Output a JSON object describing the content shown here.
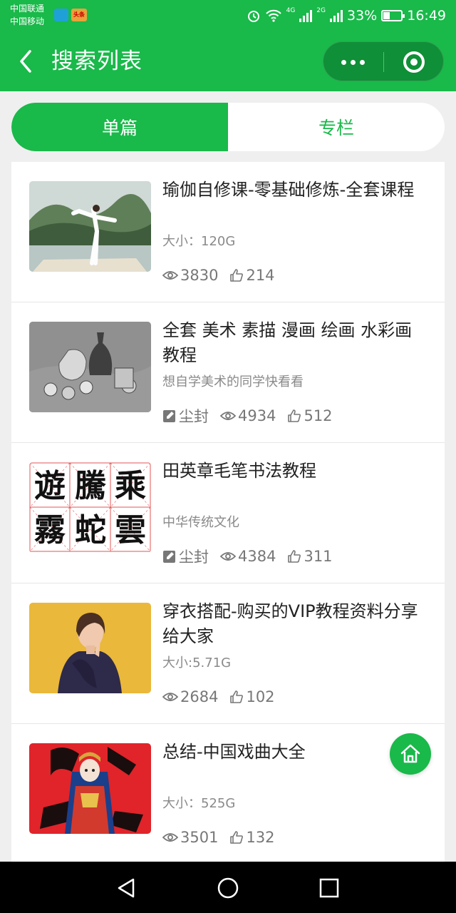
{
  "status_bar": {
    "carrier_1": "中国联通",
    "carrier_2": "中国移动",
    "mini_app_2": "头条",
    "network_1": "4G",
    "network_2": "2G",
    "battery": "33%",
    "time": "16:49"
  },
  "header": {
    "title": "搜索列表",
    "back_icon": "chevron-left-icon",
    "more_icon": "more-dots-icon",
    "close_icon": "target-circle-icon"
  },
  "tabs": [
    {
      "label": "单篇",
      "active": true
    },
    {
      "label": "专栏",
      "active": false
    }
  ],
  "list": [
    {
      "title": "瑜伽自修课-零基础修炼-全套课程",
      "subtitle": "大小：120G",
      "author": "",
      "views": "3830",
      "likes": "214",
      "thumb_desc": "yoga"
    },
    {
      "title": "全套 美术 素描 漫画 绘画 水彩画 教程",
      "subtitle": "想自学美术的同学快看看",
      "author": "尘封",
      "views": "4934",
      "likes": "512",
      "thumb_desc": "sketch"
    },
    {
      "title": "田英章毛笔书法教程",
      "subtitle": "中华传统文化",
      "author": "尘封",
      "views": "4384",
      "likes": "311",
      "thumb_desc": "calligraphy",
      "calligraphy_text": [
        "遊",
        "騰",
        "乘",
        "霧",
        "蛇",
        "雲"
      ]
    },
    {
      "title": "穿衣搭配-购买的VIP教程资料分享给大家",
      "subtitle": "大小:5.71G",
      "author": "",
      "views": "2684",
      "likes": "102",
      "thumb_desc": "fashion"
    },
    {
      "title": "总结-中国戏曲大全",
      "subtitle": "大小：525G",
      "author": "",
      "views": "3501",
      "likes": "132",
      "thumb_desc": "opera"
    }
  ],
  "colors": {
    "brand_green": "#19b94a",
    "capsule_green": "#0f8f37",
    "text_dark": "#222222",
    "text_muted": "#8a8a8a"
  },
  "icons": {
    "views": "eye-icon",
    "likes": "thumbs-up-icon",
    "author": "edit-icon",
    "home": "home-icon",
    "nav_back": "triangle-back-icon",
    "nav_home": "circle-home-icon",
    "nav_recent": "square-recents-icon"
  }
}
